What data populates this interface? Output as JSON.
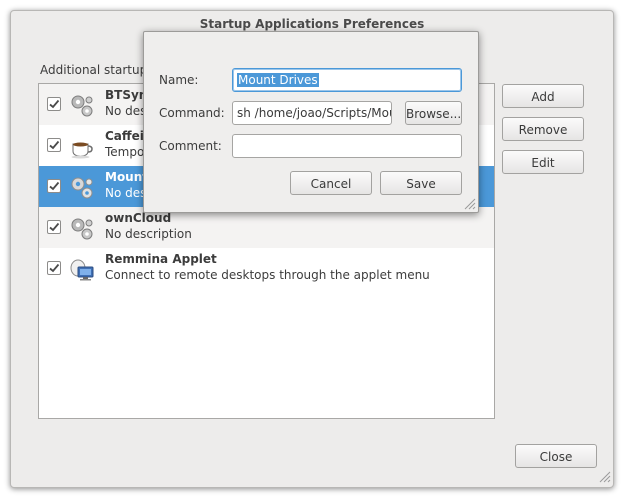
{
  "window": {
    "title": "Startup Applications Preferences"
  },
  "intro_label": "Additional startup p",
  "apps": [
    {
      "name": "BTSync",
      "name_visible": "BTSync",
      "description": "No desc",
      "checked": true,
      "icon": "gears-icon"
    },
    {
      "name": "Caffeine",
      "name_visible": "Caffein",
      "description": "Tempor",
      "checked": true,
      "icon": "coffee-cup-icon"
    },
    {
      "name": "Mount",
      "name_visible": "Mount",
      "description": "No desc",
      "checked": true,
      "icon": "gears-icon",
      "selected": true
    },
    {
      "name": "ownCloud",
      "name_visible": "ownCloud",
      "description": "No description",
      "checked": true,
      "icon": "gears-icon"
    },
    {
      "name": "Remmina Applet",
      "name_visible": "Remmina Applet",
      "description": "Connect to remote desktops through the applet menu",
      "checked": true,
      "icon": "remote-desktop-icon"
    }
  ],
  "buttons": {
    "add": "Add",
    "remove": "Remove",
    "edit": "Edit",
    "close": "Close"
  },
  "dialog": {
    "name_label": "Name:",
    "name_value": "Mount Drives",
    "command_label": "Command:",
    "command_value": "sh /home/joao/Scripts/Mour",
    "browse": "Browse...",
    "comment_label": "Comment:",
    "comment_value": "",
    "cancel": "Cancel",
    "save": "Save"
  },
  "colors": {
    "selection": "#4b98d8",
    "window_bg": "#edeceb"
  }
}
